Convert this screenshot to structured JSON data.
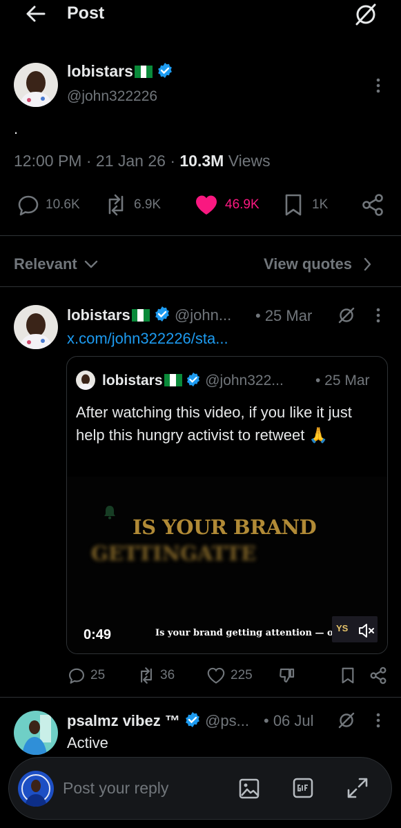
{
  "header": {
    "title": "Post"
  },
  "post": {
    "display_name": "lobistars",
    "handle": "@john322226",
    "body": ".",
    "time": "12:00 PM",
    "date": "21 Jan 26",
    "views_count": "10.3M",
    "views_label": "Views",
    "replies": "10.6K",
    "reposts": "6.9K",
    "likes": "46.9K",
    "bookmarks": "1K"
  },
  "filter": {
    "label": "Relevant",
    "view_quotes": "View quotes"
  },
  "reply1": {
    "display_name": "lobistars",
    "handle": "@john...",
    "date": "• 25 Mar",
    "link": "x.com/john322226/sta...",
    "quote": {
      "display_name": "lobistars",
      "handle": "@john322...",
      "date": "• 25 Mar",
      "text": "After watching this video, if you like it just help this hungry activist to retweet 🙏",
      "video": {
        "headline1": "IS YOUR BRAND",
        "headline2": "GETTINGATTE",
        "duration": "0:49",
        "caption": "Is your brand getting attention — or",
        "watermark": "YS"
      }
    },
    "replies": "25",
    "reposts": "36",
    "likes": "225"
  },
  "reply2": {
    "display_name": "psalmz vibez ™",
    "handle": "@ps...",
    "date": "• 06 Jul",
    "text": "Active"
  },
  "composer": {
    "placeholder": "Post your reply"
  },
  "colors": {
    "like": "#f91880",
    "link": "#1d9bf0",
    "verified": "#1d9bf0"
  }
}
